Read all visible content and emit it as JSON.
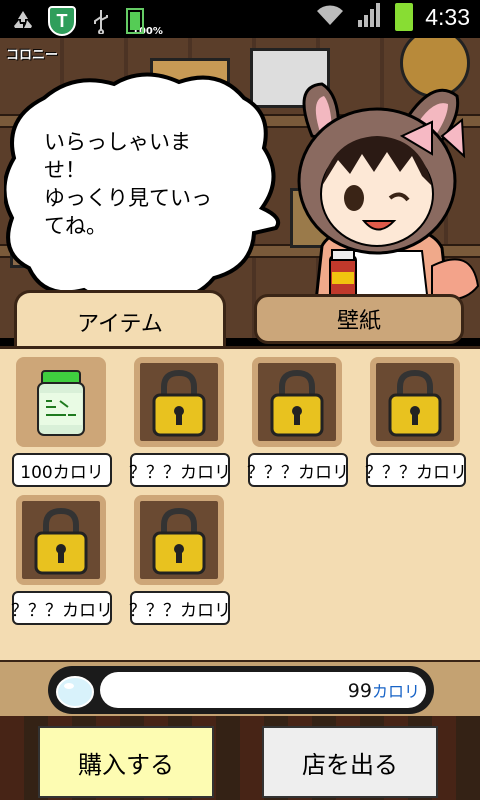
{
  "status_bar": {
    "time": "4:33",
    "battery_small_pct": "100%",
    "icons": [
      "recycle-icon",
      "shield-app-icon",
      "usb-icon",
      "battery-small-icon",
      "wifi-icon",
      "signal-icon",
      "battery-icon"
    ]
  },
  "scene": {
    "colony_label": "コロニー",
    "bubble_text_lines": [
      "いらっしゃいま",
      "せ！",
      "ゆっくり見ていっ",
      "てね。"
    ]
  },
  "tabs": [
    {
      "label": "アイテム",
      "active": true
    },
    {
      "label": "壁紙",
      "active": false
    }
  ],
  "items": [
    {
      "price": "100カロリ",
      "locked": false,
      "icon": "supplement-bottle-icon"
    },
    {
      "price": "？？？カロリ",
      "locked": true,
      "icon": "padlock-icon"
    },
    {
      "price": "？？？カロリ",
      "locked": true,
      "icon": "padlock-icon"
    },
    {
      "price": "？？？カロリ",
      "locked": true,
      "icon": "padlock-icon"
    },
    {
      "price": "？？？カロリ",
      "locked": true,
      "icon": "padlock-icon"
    },
    {
      "price": "？？？カロリ",
      "locked": true,
      "icon": "padlock-icon"
    }
  ],
  "calorie": {
    "value": "99",
    "unit": "カロリ",
    "fill_percent": 0
  },
  "buttons": {
    "buy": "購入する",
    "exit": "店を出る"
  },
  "colors": {
    "panel": "#f3dcb2",
    "tab_inactive": "#cba67a",
    "buy_button": "#fdfcb2",
    "exit_button": "#eeeeee",
    "padlock": "#e8c21f"
  }
}
